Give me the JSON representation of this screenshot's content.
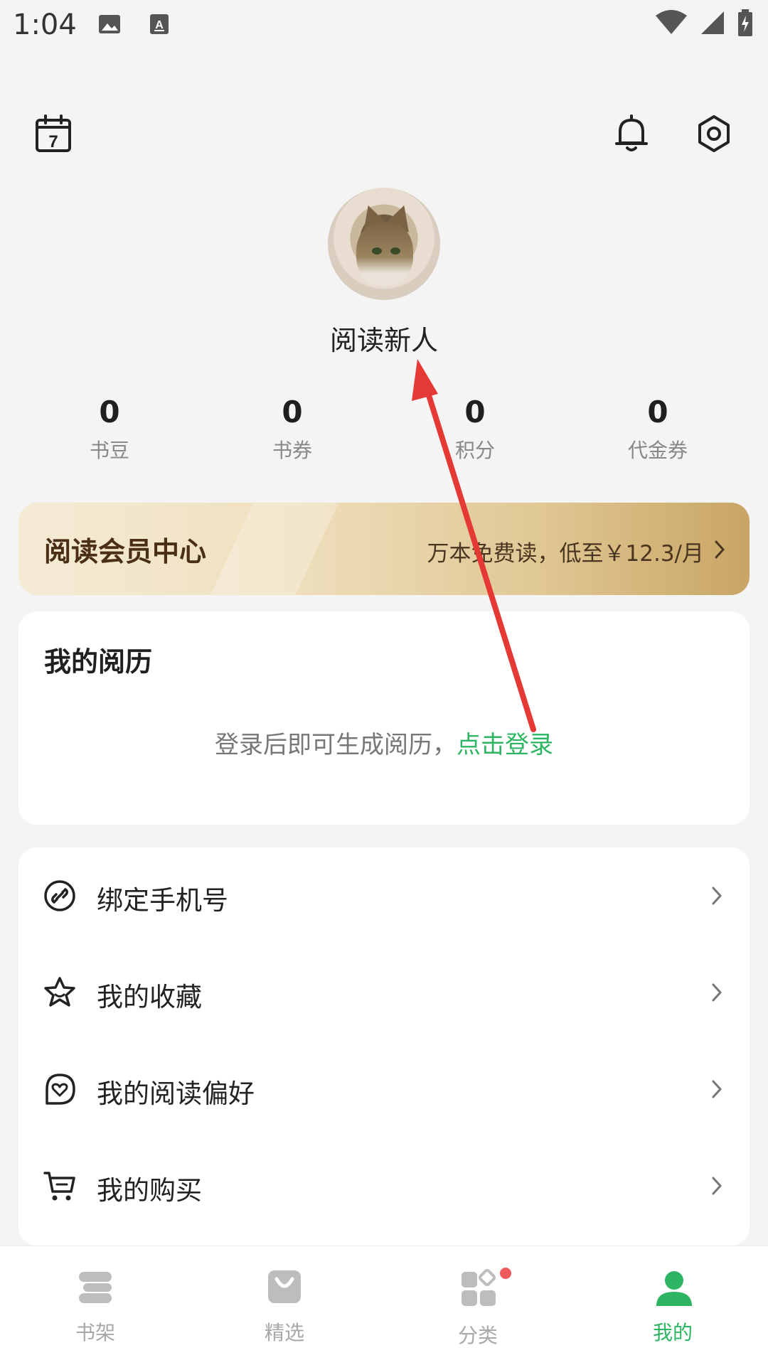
{
  "status_bar": {
    "time": "1:04",
    "left_icons": [
      "image-icon",
      "keyboard-a-icon"
    ],
    "right_icons": [
      "wifi-icon",
      "signal-icon",
      "battery-charging-icon"
    ]
  },
  "header": {
    "calendar_day": "7",
    "icons": [
      "calendar-icon",
      "bell-icon",
      "settings-icon"
    ]
  },
  "profile": {
    "username": "阅读新人"
  },
  "stats": [
    {
      "value": "0",
      "label": "书豆"
    },
    {
      "value": "0",
      "label": "书券"
    },
    {
      "value": "0",
      "label": "积分"
    },
    {
      "value": "0",
      "label": "代金券"
    }
  ],
  "vip": {
    "title": "阅读会员中心",
    "subtitle": "万本免费读，低至￥12.3/月"
  },
  "history": {
    "title": "我的阅历",
    "message": "登录后即可生成阅历，",
    "link": "点击登录"
  },
  "menu": [
    {
      "label": "绑定手机号",
      "icon": "link-icon"
    },
    {
      "label": "我的收藏",
      "icon": "star-icon"
    },
    {
      "label": "我的阅读偏好",
      "icon": "heart-bubble-icon"
    },
    {
      "label": "我的购买",
      "icon": "cart-icon"
    }
  ],
  "bottom_nav": [
    {
      "label": "书架",
      "icon": "bookshelf-icon",
      "active": false
    },
    {
      "label": "精选",
      "icon": "shopping-bag-icon",
      "active": false
    },
    {
      "label": "分类",
      "icon": "category-icon",
      "active": false,
      "badge": true
    },
    {
      "label": "我的",
      "icon": "profile-icon",
      "active": true
    }
  ],
  "colors": {
    "accent_green": "#2eb563",
    "vip_gold": "#c8a564",
    "annotation_red": "#e53935",
    "badge_red": "#f05a5a"
  }
}
